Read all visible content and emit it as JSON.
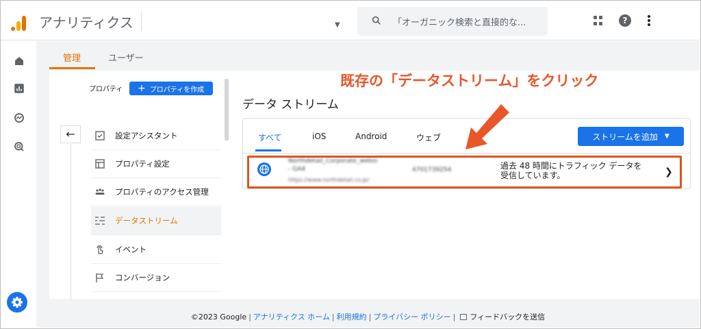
{
  "header": {
    "app_title": "アナリティクス",
    "search_placeholder": "「オーガニック検索と直接的な..."
  },
  "tabs": [
    {
      "label": "管理"
    },
    {
      "label": "ユーザー"
    }
  ],
  "property": {
    "label": "プロパティ",
    "create_button": "プロパティを作成"
  },
  "menu": [
    {
      "label": "設定アシスタント"
    },
    {
      "label": "プロパティ設定"
    },
    {
      "label": "プロパティのアクセス管理"
    },
    {
      "label": "データストリーム"
    },
    {
      "label": "イベント"
    },
    {
      "label": "コンバージョン"
    }
  ],
  "main": {
    "title": "データ ストリーム",
    "annotation": "既存の「データストリーム」をクリック",
    "filters": [
      {
        "label": "すべて"
      },
      {
        "label": "iOS"
      },
      {
        "label": "Android"
      },
      {
        "label": "ウェブ"
      }
    ],
    "add_stream_button": "ストリームを追加",
    "stream": {
      "name_line1": "Northdetail_Corporate_websi",
      "name_line2": "- GA4",
      "url": "https://www.northdetail.co.jp/",
      "id": "4701739254",
      "status_line1": "過去 48 時間にトラフィック データを",
      "status_line2": "受信しています。"
    }
  },
  "footer": {
    "copyright": "©2023 Google",
    "link_home": "アナリティクス ホーム",
    "link_terms": "利用規約",
    "link_privacy": "プライバシー ポリシー",
    "feedback": "フィードバックを送信"
  },
  "colors": {
    "accent_orange": "#e37400",
    "primary_blue": "#1a73e8",
    "annotation_red": "#e8572a"
  }
}
